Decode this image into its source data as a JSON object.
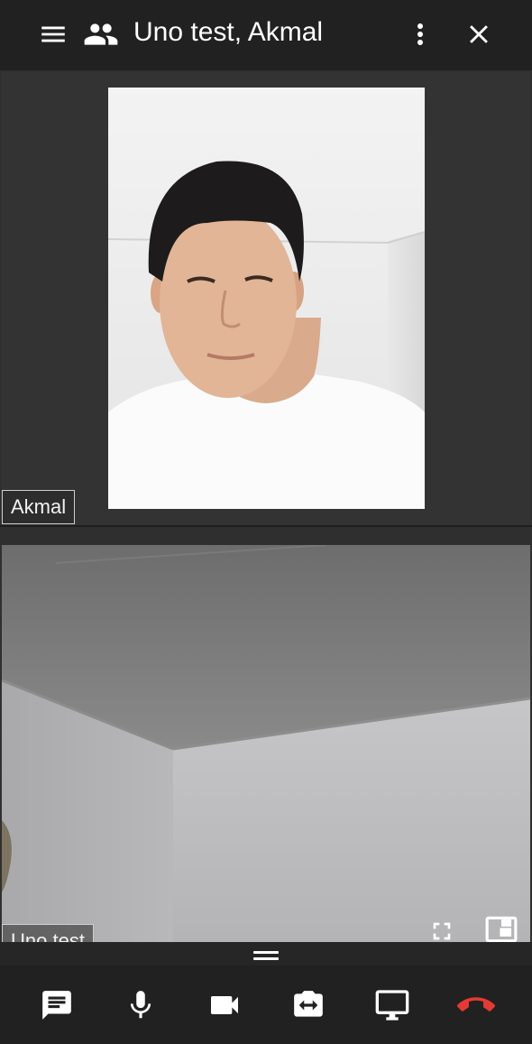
{
  "header": {
    "title": "Uno test, Akmal",
    "icons": [
      "menu-icon",
      "people-icon",
      "more-vertical-icon",
      "close-icon"
    ]
  },
  "participants": [
    {
      "name": "Akmal"
    },
    {
      "name": "Uno test"
    }
  ],
  "tile_controls": [
    "fullscreen-icon",
    "picture-in-picture-icon"
  ],
  "toolbar": {
    "buttons": [
      "chat-icon",
      "microphone-icon",
      "videocam-icon",
      "switch-camera-icon",
      "screen-share-icon",
      "hang-up-icon"
    ]
  },
  "colors": {
    "header_bg": "#212121",
    "tile_bg": "#333333",
    "hangup": "#e53935"
  }
}
